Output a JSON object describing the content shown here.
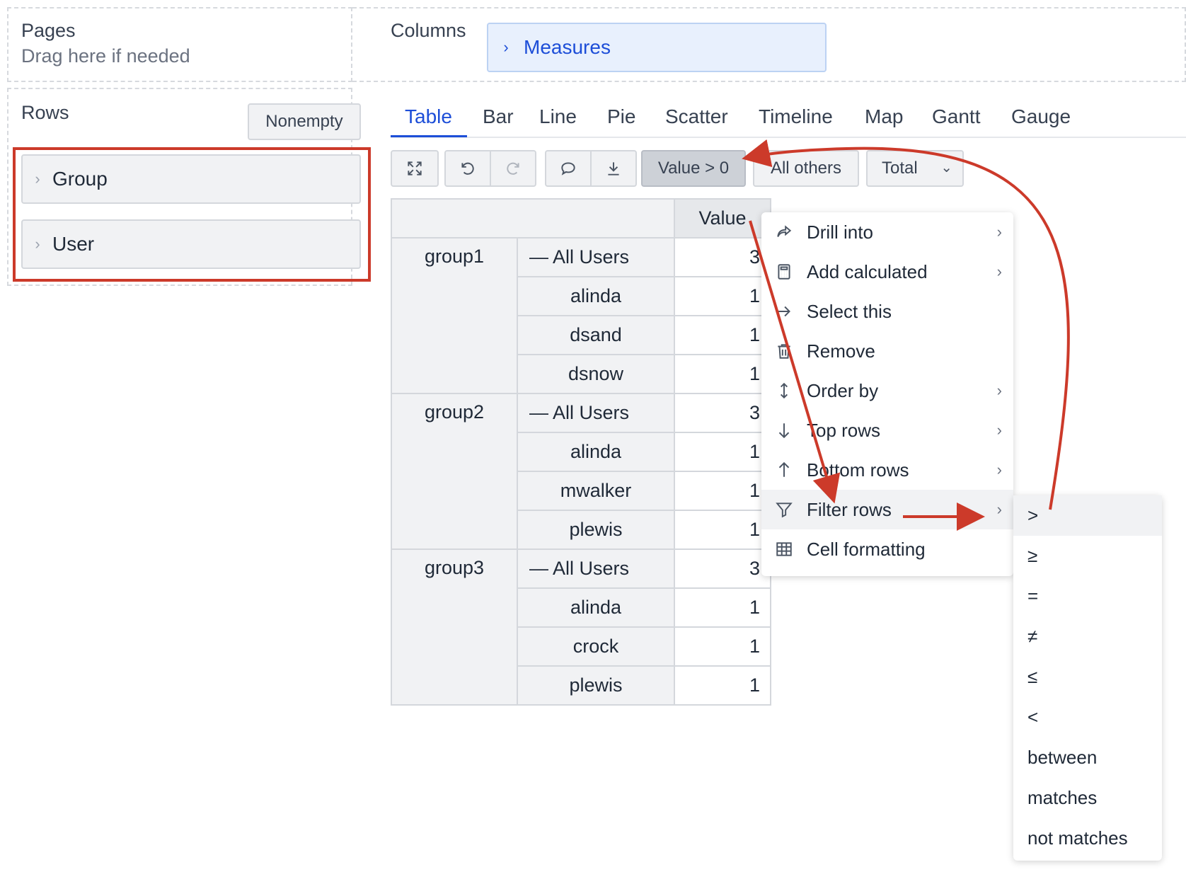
{
  "pages": {
    "title": "Pages",
    "hint": "Drag here if needed"
  },
  "columns": {
    "title": "Columns",
    "chip": "Measures"
  },
  "rows": {
    "title": "Rows",
    "nonempty_label": "Nonempty",
    "chips": [
      "Group",
      "User"
    ]
  },
  "tabs": [
    "Table",
    "Bar",
    "Line",
    "Pie",
    "Scatter",
    "Timeline",
    "Map",
    "Gantt",
    "Gauge"
  ],
  "active_tab": "Table",
  "toolbar": {
    "icons": [
      "fullscreen-icon",
      "undo-icon",
      "redo-icon",
      "comment-icon",
      "download-icon"
    ],
    "filter_label": "Value > 0",
    "all_others_label": "All others",
    "total_label": "Total"
  },
  "table": {
    "header_value": "Value",
    "groups": [
      {
        "name": "group1",
        "rows": [
          {
            "user": "— All Users",
            "value": "3"
          },
          {
            "user": "alinda",
            "value": "1"
          },
          {
            "user": "dsand",
            "value": "1"
          },
          {
            "user": "dsnow",
            "value": "1"
          }
        ]
      },
      {
        "name": "group2",
        "rows": [
          {
            "user": "— All Users",
            "value": "3"
          },
          {
            "user": "alinda",
            "value": "1"
          },
          {
            "user": "mwalker",
            "value": "1"
          },
          {
            "user": "plewis",
            "value": "1"
          }
        ]
      },
      {
        "name": "group3",
        "rows": [
          {
            "user": "— All Users",
            "value": "3"
          },
          {
            "user": "alinda",
            "value": "1"
          },
          {
            "user": "crock",
            "value": "1"
          },
          {
            "user": "plewis",
            "value": "1"
          }
        ]
      }
    ]
  },
  "context_menu": [
    {
      "label": "Drill into",
      "icon": "share-icon",
      "submenu": true
    },
    {
      "label": "Add calculated",
      "icon": "calculator-icon",
      "submenu": true
    },
    {
      "label": "Select this",
      "icon": "arrow-right-icon",
      "submenu": false
    },
    {
      "label": "Remove",
      "icon": "trash-icon",
      "submenu": false
    },
    {
      "label": "Order by",
      "icon": "sort-icon",
      "submenu": true
    },
    {
      "label": "Top rows",
      "icon": "arrow-down-icon",
      "submenu": true
    },
    {
      "label": "Bottom rows",
      "icon": "arrow-up-icon",
      "submenu": true
    },
    {
      "label": "Filter rows",
      "icon": "filter-icon",
      "submenu": true,
      "highlighted": true
    },
    {
      "label": "Cell formatting",
      "icon": "table-icon",
      "submenu": false
    }
  ],
  "filter_submenu": [
    ">",
    "≥",
    "=",
    "≠",
    "≤",
    "<",
    "between",
    "matches",
    "not matches"
  ],
  "colors": {
    "accent": "#1d4ed8",
    "annotation_red": "#cc3a2a",
    "chip_bg": "#f1f2f4",
    "measures_bg": "#e8f0fd"
  }
}
